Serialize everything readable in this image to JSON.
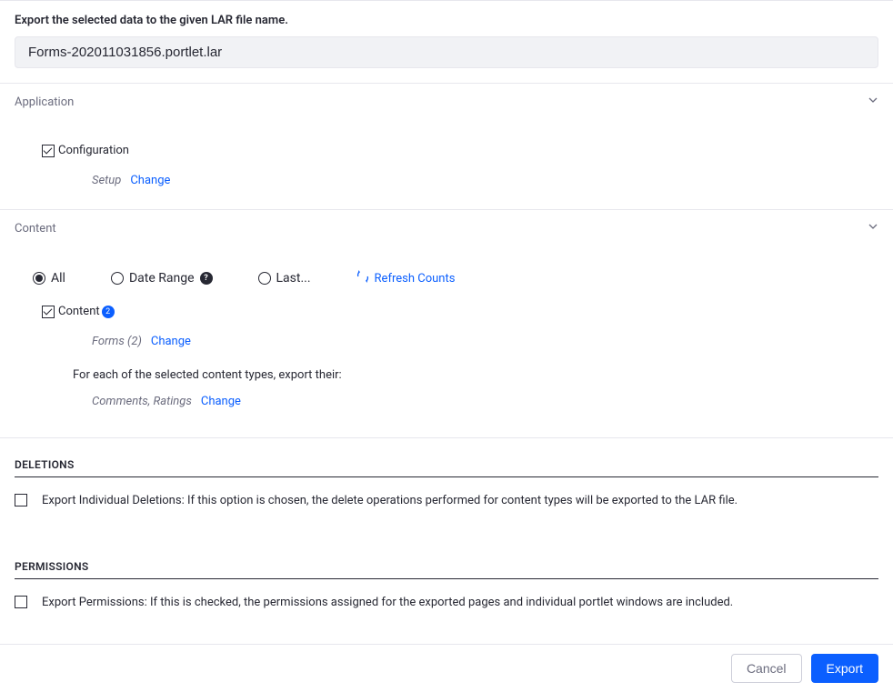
{
  "header": {
    "label": "Export the selected data to the given LAR file name.",
    "filename_value": "Forms-202011031856.portlet.lar"
  },
  "application": {
    "title": "Application",
    "configuration_label": "Configuration",
    "setup_label": "Setup",
    "change_link": "Change"
  },
  "content": {
    "title": "Content",
    "radios": {
      "all": "All",
      "date_range": "Date Range",
      "last": "Last..."
    },
    "refresh_link": "Refresh Counts",
    "content_label": "Content",
    "content_badge": "2",
    "forms_label": "Forms (2)",
    "forms_change_link": "Change",
    "explain_text": "For each of the selected content types, export their:",
    "comments_label": "Comments, Ratings",
    "comments_change_link": "Change"
  },
  "deletions": {
    "heading": "DELETIONS",
    "text": "Export Individual Deletions: If this option is chosen, the delete operations performed for content types will be exported to the LAR file."
  },
  "permissions": {
    "heading": "PERMISSIONS",
    "text": "Export Permissions: If this is checked, the permissions assigned for the exported pages and individual portlet windows are included."
  },
  "footer": {
    "cancel": "Cancel",
    "export": "Export"
  }
}
